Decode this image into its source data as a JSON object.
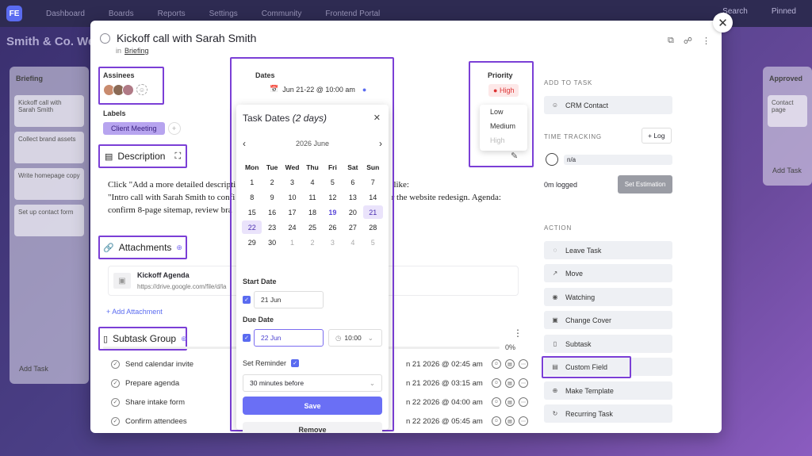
{
  "topbar": {
    "logo": "FE",
    "nav": [
      "Dashboard",
      "Boards",
      "Reports",
      "Settings",
      "Community",
      "Frontend Portal"
    ],
    "search": "Search",
    "user": "Pinned"
  },
  "board": {
    "title": "Smith & Co. Website",
    "columns": [
      {
        "name": "Briefing",
        "cards": [
          "Kickoff call with Sarah Smith",
          "Collect brand assets",
          "Write homepage copy",
          "Set up contact form"
        ],
        "add": "Add Task"
      },
      {
        "name": "Approved",
        "cards": [
          "Contact page"
        ],
        "add": "Add Task"
      }
    ]
  },
  "task": {
    "title": "Kickoff call with Sarah Smith",
    "in_label": "in",
    "list": "Briefing",
    "assignees_label": "Assinees",
    "labels_label": "Labels",
    "label_chip": "Client Meeting",
    "description_label": "Description",
    "description_line1": "Click \"Add a more detailed descripti",
    "description_line1b": "like:",
    "description_line2": "\"Intro call with Sarah Smith to confi",
    "description_line2b": "r the website redesign. Agenda:",
    "description_line3": "confirm 8-page sitemap, review bra",
    "attachments_label": "Attachments",
    "attachment": {
      "name": "Kickoff Agenda",
      "url": "https://drive.google.com/file/d/la"
    },
    "add_attachment": "+ Add Attachment",
    "subtask_group_label": "Subtask Group",
    "subtask_pct": "0%",
    "subtasks": [
      {
        "name": "Send calendar invite",
        "date": "n 21 2026 @ 02:45 am"
      },
      {
        "name": "Prepare agenda",
        "date": "n 21 2026 @ 03:15 am"
      },
      {
        "name": "Share intake form",
        "date": "n 22 2026 @ 04:00 am"
      },
      {
        "name": "Confirm attendees",
        "date": "n 22 2026 @ 05:45 am"
      }
    ]
  },
  "dates": {
    "label": "Dates",
    "value": "Jun 21-22 @ 10:00 am",
    "popover_title": "Task Dates",
    "popover_duration": "(2 days)",
    "month": "2026 June",
    "weekdays": [
      "Mon",
      "Tue",
      "Wed",
      "Thu",
      "Fri",
      "Sat",
      "Sun"
    ],
    "days": [
      "1",
      "2",
      "3",
      "4",
      "5",
      "6",
      "7",
      "8",
      "9",
      "10",
      "11",
      "12",
      "13",
      "14",
      "15",
      "16",
      "17",
      "18",
      "19",
      "20",
      "21",
      "22",
      "23",
      "24",
      "25",
      "26",
      "27",
      "28",
      "29",
      "30",
      "1",
      "2",
      "3",
      "4",
      "5"
    ],
    "start_label": "Start Date",
    "start_value": "21 Jun",
    "due_label": "Due Date",
    "due_value": "22 Jun",
    "due_time": "10:00",
    "reminder_label": "Set Reminder",
    "reminder_value": "30 minutes before",
    "save": "Save",
    "remove": "Remove"
  },
  "priority": {
    "label": "Priority",
    "value": "High",
    "options": [
      "Low",
      "Medium",
      "High"
    ]
  },
  "rail": {
    "add_to_task": "ADD TO TASK",
    "crm": "CRM Contact",
    "time_tracking": "TIME TRACKING",
    "log": "+ Log",
    "tt_value": "n/a",
    "logged": "0m logged",
    "set_estimation": "Set Estimation",
    "action": "ACTION",
    "actions": [
      "Leave Task",
      "Move",
      "Watching",
      "Change Cover",
      "Subtask",
      "Custom Field",
      "Make Template",
      "Recurring Task"
    ]
  },
  "colors": {
    "accent": "#6a6ff5",
    "highlight": "#7b3fd6",
    "priority_high": "#d33333",
    "label_chip": "#b7a4ef"
  }
}
